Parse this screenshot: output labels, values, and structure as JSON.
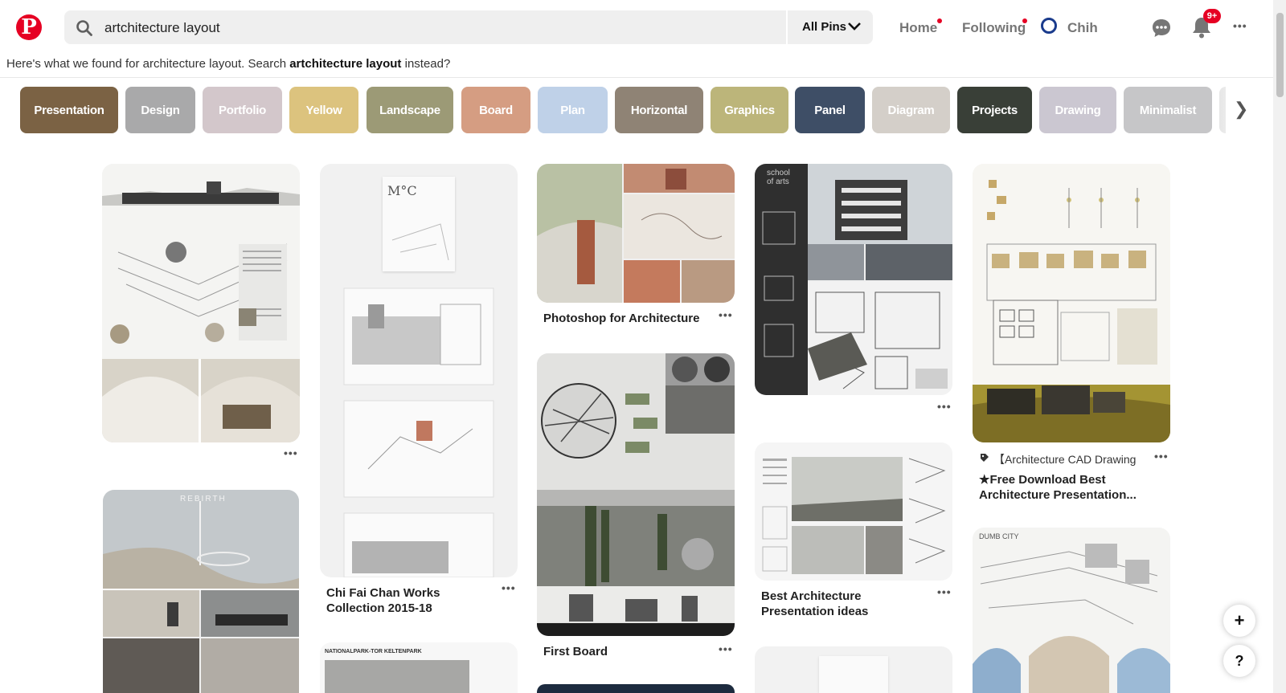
{
  "header": {
    "logo": "P",
    "search_value": "artchitecture layout",
    "clear_glyph": "✕",
    "scope_label": "All Pins",
    "nav_home": "Home",
    "nav_following": "Following",
    "nav_profile": "Chih",
    "badge": "9+",
    "more_glyph": "•••"
  },
  "notice": {
    "prefix": "Here's what we found for architecture layout. Search ",
    "alt_query": "artchitecture layout",
    "suffix": " instead?"
  },
  "chips": [
    {
      "label": "Presentation",
      "color": "#7b6244"
    },
    {
      "label": "Design",
      "color": "#a9a9aa"
    },
    {
      "label": "Portfolio",
      "color": "#d3c7cb"
    },
    {
      "label": "Yellow",
      "color": "#dcc37e"
    },
    {
      "label": "Landscape",
      "color": "#9c9a76"
    },
    {
      "label": "Board",
      "color": "#d59d82"
    },
    {
      "label": "Plan",
      "color": "#bfd1e8"
    },
    {
      "label": "Horizontal",
      "color": "#8f8375"
    },
    {
      "label": "Graphics",
      "color": "#bcb57a"
    },
    {
      "label": "Panel",
      "color": "#3e4e66"
    },
    {
      "label": "Diagram",
      "color": "#d4cfc9"
    },
    {
      "label": "Projects",
      "color": "#393f37"
    },
    {
      "label": "Drawing",
      "color": "#cbc7d1"
    },
    {
      "label": "Minimalist",
      "color": "#c6c6c8"
    }
  ],
  "pins": {
    "c1a": {
      "more": "•••"
    },
    "c1b": {
      "more": "•••",
      "poster_text": "REBIRTH"
    },
    "c2a": {
      "title": "Chi Fai Chan Works Collection 2015-18",
      "more": "•••",
      "cover_text": "M°C"
    },
    "c2b": {
      "poster_text": "NATIONALPARK-TOR KELTENPARK"
    },
    "c3a": {
      "title": "Photoshop for Architecture",
      "more": "•••"
    },
    "c3b": {
      "title": "First Board",
      "more": "•••"
    },
    "c4a": {
      "more": "•••",
      "poster_text": "school of arts"
    },
    "c4b": {
      "title": "Best Architecture Presentation ideas",
      "more": "•••"
    },
    "c5a": {
      "tag": "【Architecture CAD Drawing",
      "title": "★Free Download Best Architecture Presentation...",
      "more": "•••"
    },
    "c5b": {
      "poster_text": "DUMB CITY"
    }
  },
  "fab": {
    "add": "+",
    "help": "?"
  }
}
